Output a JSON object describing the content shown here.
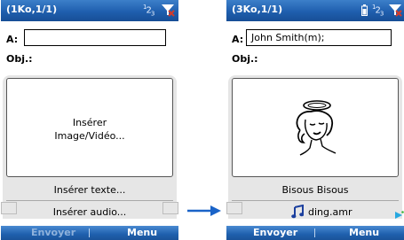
{
  "left_screen": {
    "title": "(1Ko,1/1)",
    "to_label": "A:",
    "to_value": "",
    "subject_label": "Obj.:",
    "media_placeholder_line1": "Insérer",
    "media_placeholder_line2": "Image/Vidéo...",
    "insert_text": "Insérer texte...",
    "insert_audio": "Insérer audio...",
    "softkey_left": "Envoyer",
    "softkey_right": "Menu",
    "softkey_left_enabled": false
  },
  "right_screen": {
    "title": "(3Ko,1/1)",
    "to_label": "A:",
    "to_value": "John Smith(m);",
    "subject_label": "Obj.:",
    "caption_text": "Bisous Bisous",
    "audio_file": "ding.amr",
    "softkey_left": "Envoyer",
    "softkey_right": "Menu",
    "softkey_left_enabled": true
  },
  "icons": {
    "input_mode": "123-input-mode-icon",
    "signal": "signal-off-icon",
    "battery": "battery-icon",
    "audio": "music-note-icon",
    "transition": "right-arrow-icon"
  },
  "colors": {
    "titlebar": "#1f5fae",
    "softbar": "#1f60ad",
    "arrow": "#1a63c8",
    "signal_x": "#d23a2a",
    "play_indicator": "#27a8e0"
  }
}
